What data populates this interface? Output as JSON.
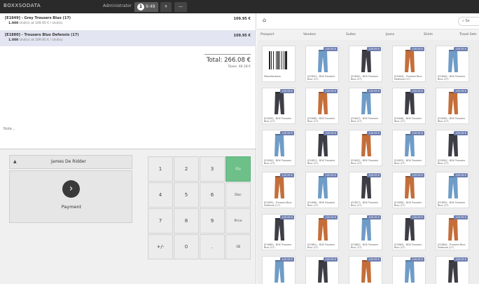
{
  "topbar": {
    "logo": "BOXXSODATA",
    "user": "Administrator",
    "tabs": [
      {
        "number": "1",
        "label": "9:49"
      },
      {
        "label": "+"
      },
      {
        "label": "—"
      }
    ]
  },
  "order": {
    "lines": [
      {
        "name": "[E1849] - Grey Trousers Bluo (17)",
        "qty": "1.000",
        "unit_info": "Unit(s) at 109.95 € / Unit(s)",
        "price": "109.95 €"
      },
      {
        "name": "[E1880] - Trousers Bluo Defensio (17)",
        "qty": "1.000",
        "unit_info": "Unit(s) at 109.95 € / Unit(s)",
        "price": "109.95 €"
      }
    ],
    "total": "Total: 266.08 €",
    "taxes": "Taxes: 46.18 €",
    "note": "Note..."
  },
  "customer": {
    "caret": "▲",
    "name": "James De Ridder"
  },
  "payment": {
    "label": "Payment",
    "icon": "chevron-right-icon"
  },
  "numpad": {
    "keys": [
      [
        "1",
        "2",
        "3",
        "Qty"
      ],
      [
        "4",
        "5",
        "6",
        "Disc"
      ],
      [
        "7",
        "8",
        "9",
        "Price"
      ],
      [
        "+/-",
        "0",
        ".",
        "⌫"
      ]
    ]
  },
  "products": {
    "home_icon": "home-icon",
    "search_placeholder": "Se",
    "categories": [
      "Prospect",
      "Vendors",
      "Suites",
      "Jeans",
      "Shirts",
      "Travel Sets"
    ],
    "price_tag": "109.95 €",
    "items": [
      {
        "name": "Miscellaneous",
        "kind": "barcode"
      },
      {
        "name": "[E1841] - BOX Trousers Bluo (17)",
        "color": "#6f9cc7"
      },
      {
        "name": "[E1842] - BOX Trousers Bluo (17)",
        "color": "#3d3d45"
      },
      {
        "name": "[E1843] - Trousers Bluo Defensio (17)",
        "color": "#c46e3a"
      },
      {
        "name": "[E1844] - BOX Trousers Bluo (17)",
        "color": "#6f9cc7"
      },
      {
        "name": "[E1845] - BOX Trousers Bluo (17)",
        "color": "#3d3d45"
      },
      {
        "name": "[E1846] - BOX Trousers Bluo (17)",
        "color": "#c46e3a"
      },
      {
        "name": "[E1847] - BOX Trousers Bluo (17)",
        "color": "#6f9cc7"
      },
      {
        "name": "[E1848] - BOX Trousers Bluo (17)",
        "color": "#3d3d45"
      },
      {
        "name": "[E1849] - BOX Trousers Bluo (17)",
        "color": "#c46e3a"
      },
      {
        "name": "[E1850] - BOX Trousers Bluo (17)",
        "color": "#6f9cc7"
      },
      {
        "name": "[E1851] - BOX Trousers Bluo (17)",
        "color": "#3d3d45"
      },
      {
        "name": "[E1852] - BOX Trousers Bluo (17)",
        "color": "#c46e3a"
      },
      {
        "name": "[E1853] - BOX Trousers Bluo (17)",
        "color": "#6f9cc7"
      },
      {
        "name": "[E1854] - BOX Trousers Bluo (17)",
        "color": "#3d3d45"
      },
      {
        "name": "[E1855] - Trousers Bluo Defensio (17)",
        "color": "#c46e3a"
      },
      {
        "name": "[E1856] - BOX Trousers Bluo (17)",
        "color": "#6f9cc7"
      },
      {
        "name": "[E1857] - BOX Trousers Bluo (17)",
        "color": "#3d3d45"
      },
      {
        "name": "[E1858] - BOX Trousers Bluo (17)",
        "color": "#c46e3a"
      },
      {
        "name": "[E1859] - BOX Trousers Bluo (17)",
        "color": "#6f9cc7"
      },
      {
        "name": "[E1860] - BOX Trousers Bluo (17)",
        "color": "#3d3d45"
      },
      {
        "name": "[E1861] - BOX Trousers Bluo (17)",
        "color": "#c46e3a"
      },
      {
        "name": "[E1862] - BOX Trousers Bluo (17)",
        "color": "#6f9cc7"
      },
      {
        "name": "[E1863] - BOX Trousers Bluo (17)",
        "color": "#3d3d45"
      },
      {
        "name": "[E1864] - Trousers Bluo Defensio (17)",
        "color": "#c46e3a"
      },
      {
        "name": "",
        "color": "#6f9cc7"
      },
      {
        "name": "",
        "color": "#3d3d45"
      },
      {
        "name": "",
        "color": "#c46e3a"
      },
      {
        "name": "",
        "color": "#6f9cc7"
      },
      {
        "name": "",
        "color": "#3d3d45"
      }
    ]
  },
  "colors": {
    "accent_green": "#6ec089",
    "topbar": "#2a2a2a",
    "selected_line": "#e3e6f2",
    "price_tag": "#6f7fb0"
  }
}
